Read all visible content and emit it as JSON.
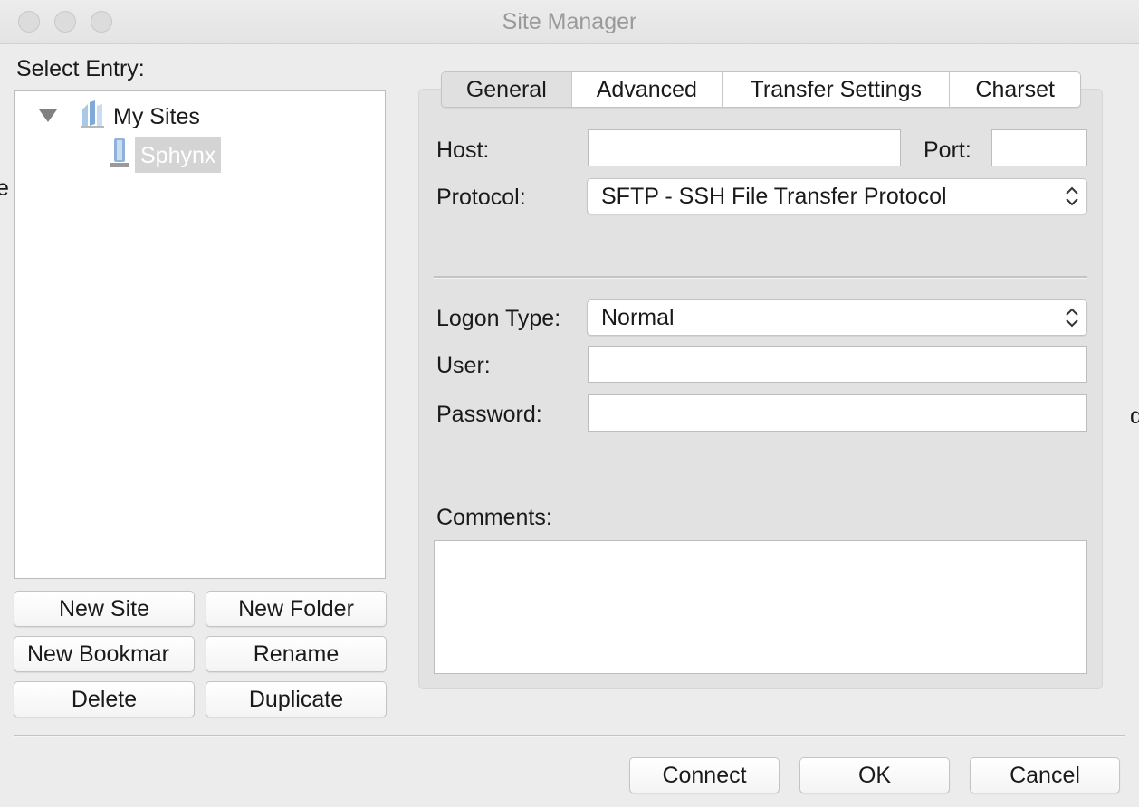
{
  "window": {
    "title": "Site Manager"
  },
  "tree": {
    "label": "Select Entry:",
    "root": {
      "label": "My Sites",
      "icon": "folder-icon"
    },
    "items": [
      {
        "label": "Sphynx",
        "icon": "server-icon",
        "selected": true
      }
    ]
  },
  "tree_buttons": {
    "new_site": "New Site",
    "new_folder": "New Folder",
    "new_bookmark": "New Bookmar",
    "rename": "Rename",
    "delete": "Delete",
    "duplicate": "Duplicate"
  },
  "tabs": [
    {
      "label": "General",
      "active": true
    },
    {
      "label": "Advanced",
      "active": false
    },
    {
      "label": "Transfer Settings",
      "active": false
    },
    {
      "label": "Charset",
      "active": false
    }
  ],
  "general": {
    "host_label": "Host:",
    "host_value": "",
    "port_label": "Port:",
    "port_value": "",
    "protocol_label": "Protocol:",
    "protocol_value": "SFTP - SSH File Transfer Protocol",
    "logon_type_label": "Logon Type:",
    "logon_type_value": "Normal",
    "user_label": "User:",
    "user_value": "",
    "password_label": "Password:",
    "password_value": "",
    "comments_label": "Comments:",
    "comments_value": ""
  },
  "footer": {
    "connect": "Connect",
    "ok": "OK",
    "cancel": "Cancel"
  },
  "colors": {
    "window_bg": "#ececec",
    "selection_bg": "#d4d4d4",
    "panel_bg": "#e2e2e2"
  }
}
